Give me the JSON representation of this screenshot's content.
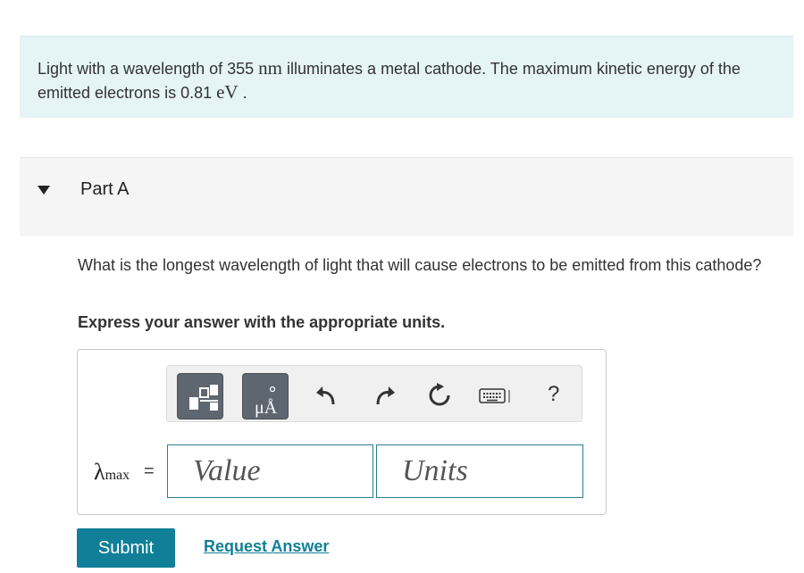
{
  "problem": {
    "text_before": "Light with a wavelength of 355 ",
    "unit_nm": "nm",
    "text_middle": " illuminates a metal cathode. The maximum kinetic energy of the emitted electrons is 0.81 ",
    "unit_ev": "eV",
    "text_after": " ."
  },
  "part": {
    "title": "Part A",
    "question": "What is the longest wavelength of light that will cause electrons to be emitted from this cathode?",
    "instruction": "Express your answer with the appropriate units."
  },
  "answer": {
    "variable": "λ",
    "subscript": "max",
    "equals": "=",
    "value_placeholder": "Value",
    "units_placeholder": "Units"
  },
  "toolbar": {
    "units_button_text": "μÅ",
    "help_label": "?"
  },
  "actions": {
    "submit_label": "Submit",
    "request_label": "Request Answer"
  },
  "colors": {
    "accent": "#117f97",
    "problem_bg": "#e5f4f5",
    "toolbar_button": "#5e6670"
  }
}
